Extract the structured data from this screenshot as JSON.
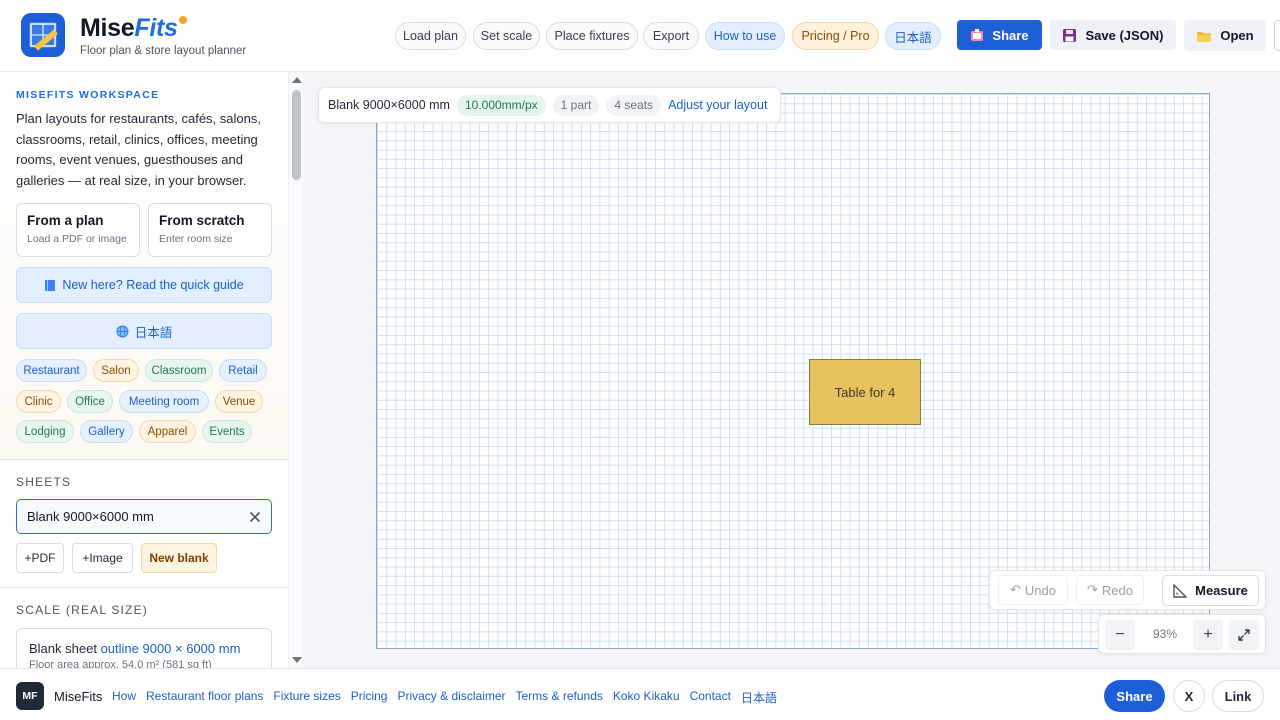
{
  "brand": {
    "name_a": "Mise",
    "name_b": "Fits",
    "tagline": "Floor plan & store layout planner"
  },
  "nav": [
    "Load plan",
    "Set scale",
    "Place fixtures",
    "Export",
    "How to use",
    "Pricing / Pro",
    "日本語"
  ],
  "actions": {
    "share": "Share",
    "save": "Save (JSON)",
    "open": "Open"
  },
  "sidebar": {
    "workspace_title": "MISEFITS WORKSPACE",
    "workspace_desc": "Plan layouts for restaurants, cafés, salons, classrooms, retail, clinics, offices, meeting rooms, event venues, guesthouses and galleries — at real size, in your browser.",
    "cards": [
      {
        "title": "From a plan",
        "sub": "Load a PDF or image"
      },
      {
        "title": "From scratch",
        "sub": "Enter room size"
      }
    ],
    "guide_btn": "New here? Read the quick guide",
    "lang_btn": "日本語",
    "tags": [
      "Restaurant",
      "Salon",
      "Classroom",
      "Retail",
      "Clinic",
      "Office",
      "Meeting room",
      "Venue",
      "Lodging",
      "Gallery",
      "Apparel",
      "Events"
    ],
    "sheets_title": "SHEETS",
    "sheet_value": "Blank 9000×6000 mm",
    "sheet_buttons": [
      "+PDF",
      "+Image",
      "New blank"
    ],
    "scale_title": "SCALE (REAL SIZE)",
    "scale_prefix": "Blank sheet",
    "scale_highlight": "outline 9000 × 6000 mm",
    "scale_sub": "Floor area approx. 54.0 m² (581 sq ft)"
  },
  "canvas": {
    "sheet_name": "Blank 9000×6000 mm",
    "scale_chip": "10.000mm/px",
    "parts_chip": "1 part",
    "seats_chip": "4 seats",
    "adjust_link": "Adjust your layout",
    "fixture_label": "Table for 4",
    "undo": "Undo",
    "redo": "Redo",
    "measure": "Measure",
    "zoom": "93%"
  },
  "footer": {
    "logo": "MF",
    "brand": "MiseFits",
    "links": [
      "How",
      "Restaurant floor plans",
      "Fixture sizes",
      "Pricing",
      "Privacy & disclaimer",
      "Terms & refunds",
      "Koko Kikaku",
      "Contact",
      "日本語"
    ],
    "share": "Share",
    "x": "X",
    "link": "Link"
  }
}
